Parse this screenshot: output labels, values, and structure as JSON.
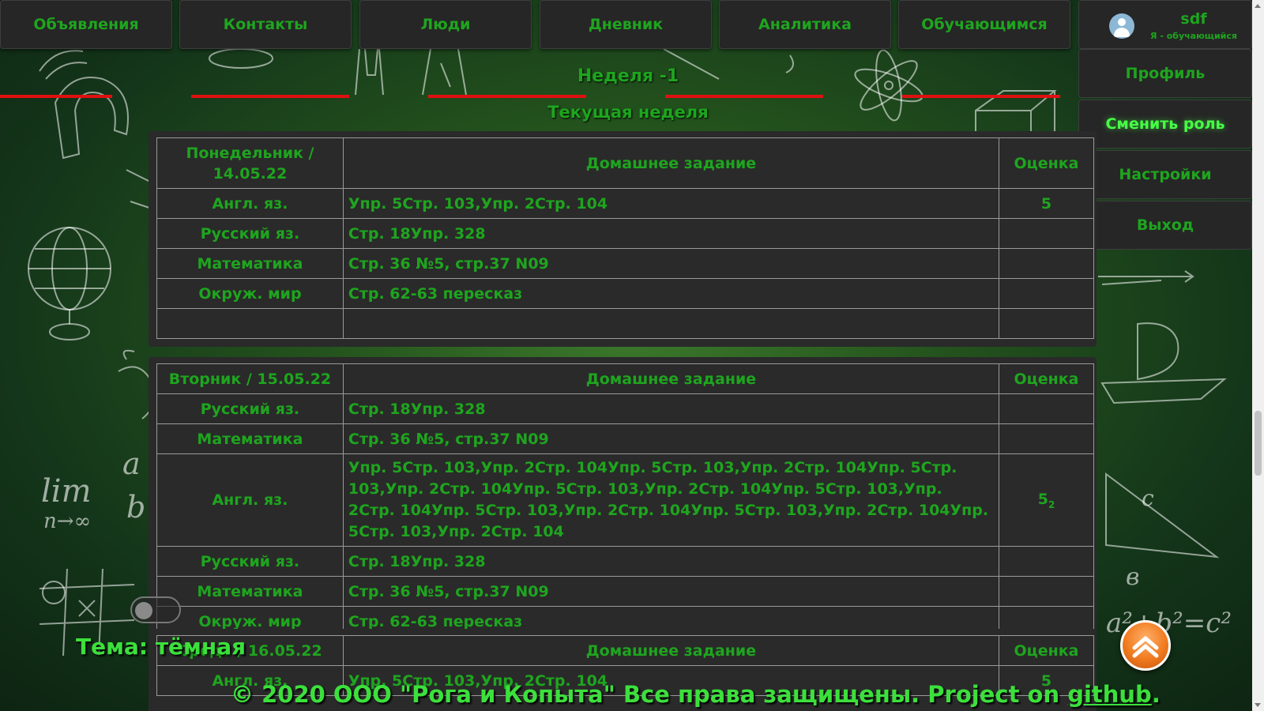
{
  "nav": {
    "items": [
      "Объявления",
      "Контакты",
      "Люди",
      "Дневник",
      "Аналитика",
      "Обучающимся"
    ]
  },
  "user": {
    "name": "sdf",
    "role": "Я - обучающийся",
    "menu": [
      "Профиль",
      "Сменить роль",
      "Настройки",
      "Выход"
    ]
  },
  "week": {
    "title": "Неделя -1",
    "subtitle": "Текущая неделя"
  },
  "columns": {
    "hw": "Домашнее задание",
    "grade": "Оценка"
  },
  "days": [
    {
      "day": "Понедельник / 14.05.22",
      "rows": [
        {
          "subject": "Англ. яз.",
          "hw": "Упр. 5Стр. 103,Упр. 2Стр. 104",
          "grade": "5"
        },
        {
          "subject": "Русский яз.",
          "hw": "Стр. 18Упр. 328",
          "grade": ""
        },
        {
          "subject": "Математика",
          "hw": "Стр. 36 №5, стр.37 N09",
          "grade": ""
        },
        {
          "subject": "Окруж. мир",
          "hw": "Стр. 62-63 пересказ",
          "grade": ""
        },
        {
          "subject": "",
          "hw": "",
          "grade": ""
        }
      ]
    },
    {
      "day": "Вторник / 15.05.22",
      "rows": [
        {
          "subject": "Русский яз.",
          "hw": "Стр. 18Упр. 328",
          "grade": ""
        },
        {
          "subject": "Математика",
          "hw": "Стр. 36 №5, стр.37 N09",
          "grade": ""
        },
        {
          "subject": "Англ. яз.",
          "hw": "Упр. 5Стр. 103,Упр. 2Стр. 104Упр. 5Стр. 103,Упр. 2Стр. 104Упр. 5Стр. 103,Упр. 2Стр. 104Упр. 5Стр. 103,Упр. 2Стр. 104Упр. 5Стр. 103,Упр. 2Стр. 104Упр. 5Стр. 103,Упр. 2Стр. 104Упр. 5Стр. 103,Упр. 2Стр. 104Упр. 5Стр. 103,Упр. 2Стр. 104",
          "grade": "5",
          "grade_sub": "2"
        },
        {
          "subject": "Русский яз.",
          "hw": "Стр. 18Упр. 328",
          "grade": ""
        },
        {
          "subject": "Математика",
          "hw": "Стр. 36 №5, стр.37 N09",
          "grade": ""
        },
        {
          "subject": "Окруж. мир",
          "hw": "Стр. 62-63 пересказ",
          "grade": ""
        }
      ]
    },
    {
      "day": "Среда / 16.05.22",
      "rows": [
        {
          "subject": "Англ. яз.",
          "hw": "Упр. 5Стр. 103,Упр. 2Стр. 104",
          "grade": "5"
        }
      ]
    }
  ],
  "theme": {
    "label": "Тема: тёмная",
    "dark_on": false
  },
  "footer": {
    "text": "© 2020 ООО \"Рога и Копыта\" Все права защищены. Project on ",
    "link": "github",
    "end": "."
  },
  "colors": {
    "accent": "#1ea51e",
    "divider": "#e01010",
    "up_button": "#f07a1e"
  },
  "icons": {
    "avatar": "user-avatar-icon",
    "scroll_top": "chevron-up-icon"
  }
}
